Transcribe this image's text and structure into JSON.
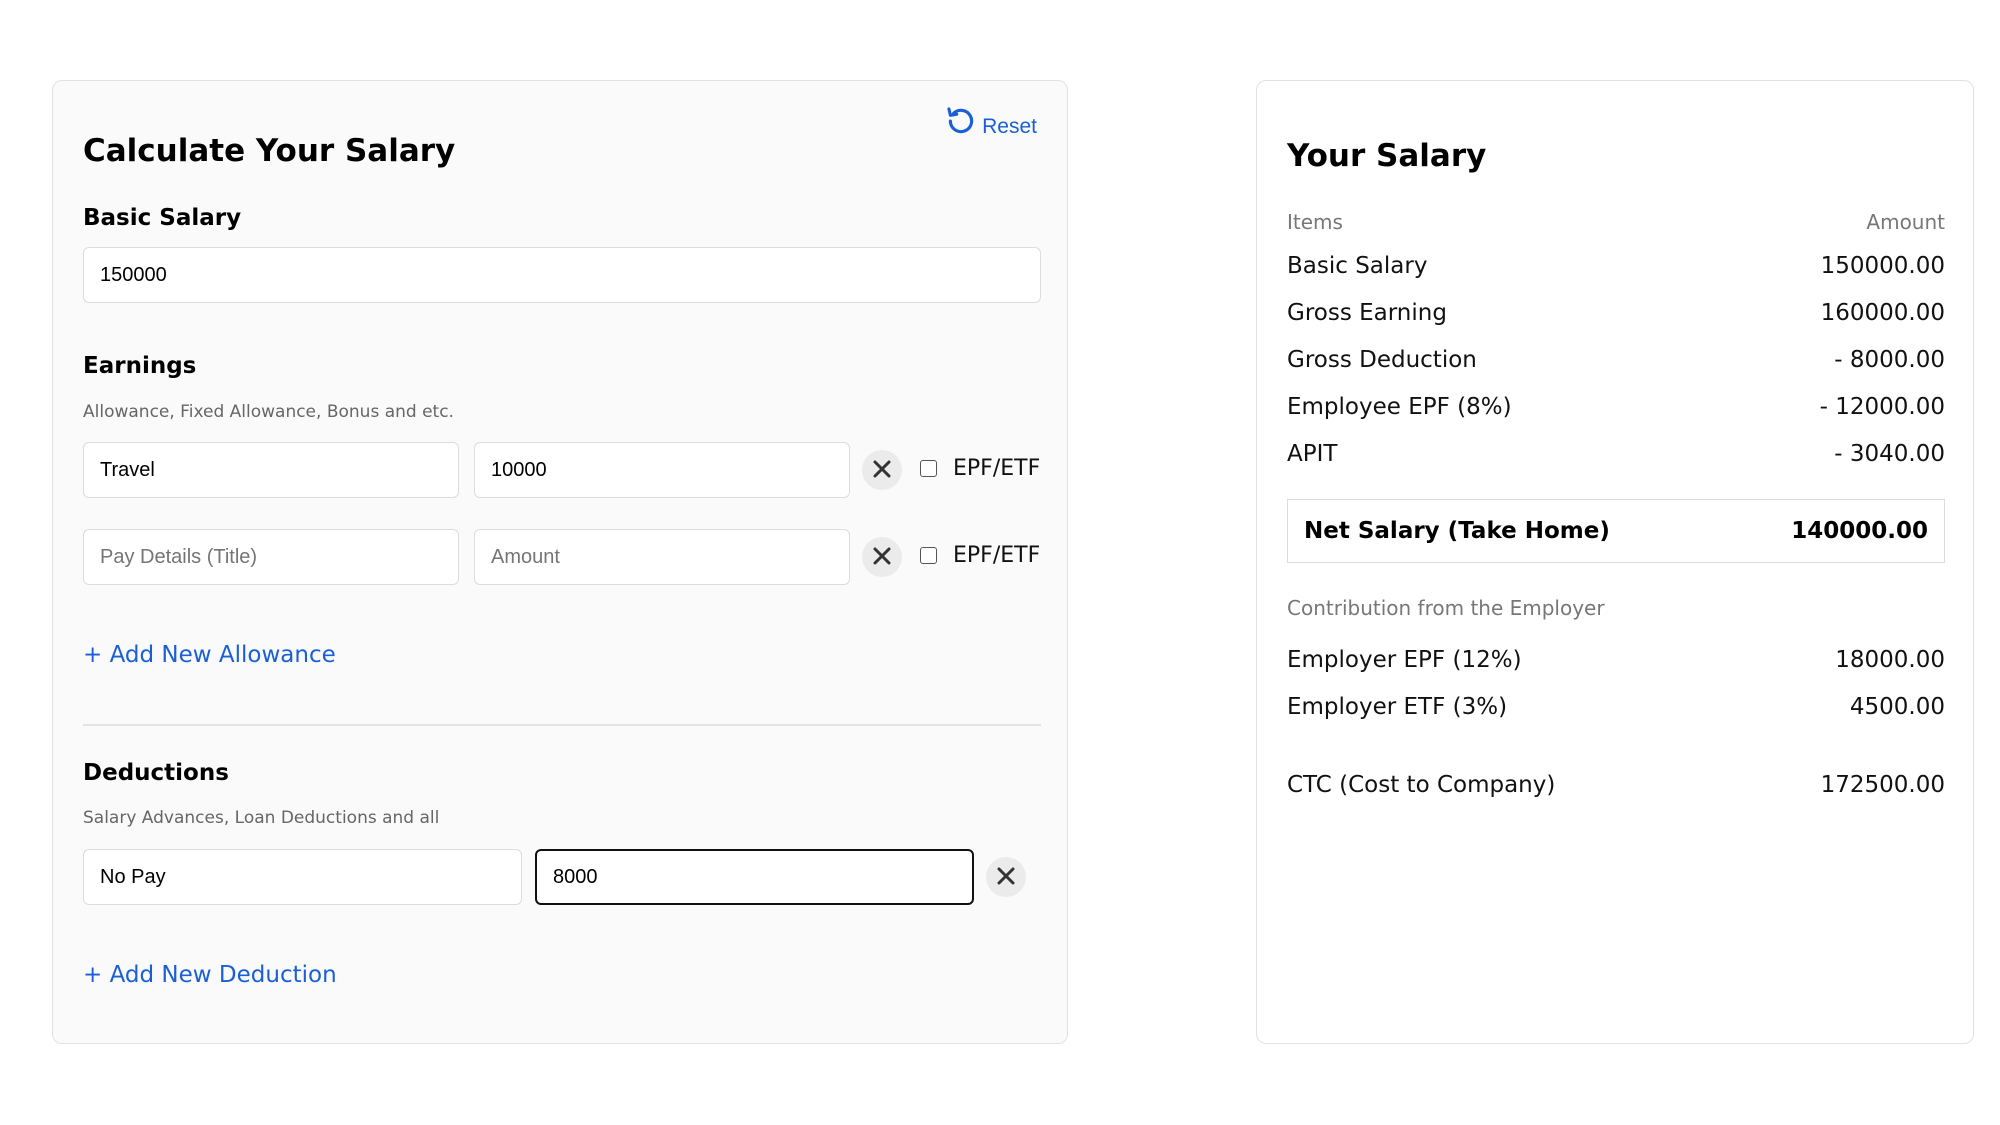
{
  "calculator": {
    "title": "Calculate Your Salary",
    "reset_label": "Reset",
    "basic_salary": {
      "label": "Basic Salary",
      "value": "150000"
    },
    "earnings": {
      "title": "Earnings",
      "subtitle": "Allowance, Fixed Allowance, Bonus and etc.",
      "rows": [
        {
          "title_value": "Travel",
          "amount_value": "10000",
          "title_placeholder": "Pay Details (Title)",
          "amount_placeholder": "Amount",
          "epf_label": "EPF/ETF",
          "epf_checked": false
        },
        {
          "title_value": "",
          "amount_value": "",
          "title_placeholder": "Pay Details (Title)",
          "amount_placeholder": "Amount",
          "epf_label": "EPF/ETF",
          "epf_checked": false
        }
      ],
      "add_label": "+ Add New Allowance"
    },
    "deductions": {
      "title": "Deductions",
      "subtitle": "Salary Advances, Loan Deductions and all",
      "rows": [
        {
          "title_value": "No Pay",
          "amount_value": "8000"
        }
      ],
      "add_label": "+ Add New Deduction"
    }
  },
  "summary": {
    "title": "Your Salary",
    "header": {
      "items": "Items",
      "amount": "Amount"
    },
    "lines": [
      {
        "label": "Basic Salary",
        "value": "150000.00"
      },
      {
        "label": "Gross Earning",
        "value": "160000.00"
      },
      {
        "label": "Gross Deduction",
        "value": "- 8000.00"
      },
      {
        "label": "Employee EPF (8%)",
        "value": "- 12000.00"
      },
      {
        "label": "APIT",
        "value": "- 3040.00"
      }
    ],
    "net": {
      "label": "Net Salary (Take Home)",
      "value": "140000.00"
    },
    "employer_label": "Contribution from the Employer",
    "employer_lines": [
      {
        "label": "Employer EPF (12%)",
        "value": "18000.00"
      },
      {
        "label": "Employer ETF (3%)",
        "value": "4500.00"
      }
    ],
    "ctc": {
      "label": "CTC (Cost to Company)",
      "value": "172500.00"
    }
  },
  "colors": {
    "accent": "#1a5fd6",
    "panel_bg": "#fafafa",
    "border": "#e2e2e2"
  },
  "icons": {
    "reset": "reset-icon",
    "remove": "close-icon"
  }
}
